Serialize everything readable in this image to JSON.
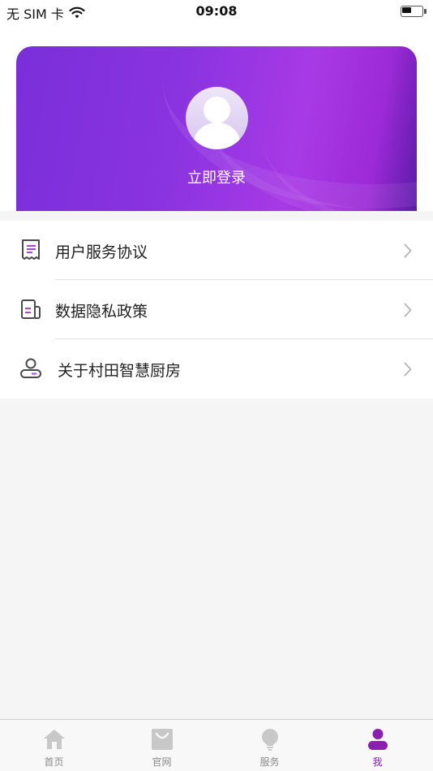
{
  "status_bar": {
    "carrier": "无 SIM 卡",
    "time": "09:08",
    "battery_level": 0.45
  },
  "profile": {
    "login_label": "立即登录",
    "gradient_colors": [
      "#7a2fd9",
      "#a83ae6",
      "#5a1aa8"
    ]
  },
  "menu": {
    "items": [
      {
        "label": "用户服务协议",
        "icon": "receipt-icon"
      },
      {
        "label": "数据隐私政策",
        "icon": "document-icon"
      },
      {
        "label": "关于村田智慧厨房",
        "icon": "user-info-icon"
      }
    ]
  },
  "tab_bar": {
    "tabs": [
      {
        "label": "首页",
        "icon": "home-icon",
        "active": false
      },
      {
        "label": "官网",
        "icon": "shopping-bag-icon",
        "active": false
      },
      {
        "label": "服务",
        "icon": "lightbulb-icon",
        "active": false
      },
      {
        "label": "我",
        "icon": "person-icon",
        "active": true
      }
    ],
    "active_color": "#8a1fb0",
    "inactive_color": "#c8c8c8"
  }
}
